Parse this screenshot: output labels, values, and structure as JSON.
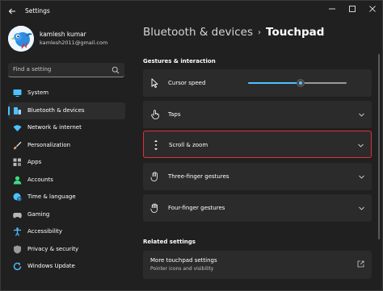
{
  "window": {
    "title": "Settings"
  },
  "profile": {
    "name": "kamlesh kumar",
    "email": "kamlesh2011@gmail.com"
  },
  "search": {
    "placeholder": "Find a setting"
  },
  "nav": {
    "items": [
      {
        "label": "System",
        "icon": "monitor-icon",
        "color": "#4cc2ff"
      },
      {
        "label": "Bluetooth & devices",
        "icon": "bluetooth-devices-icon",
        "color": "#4cc2ff",
        "active": true
      },
      {
        "label": "Network & internet",
        "icon": "wifi-icon",
        "color": "#4cc2ff"
      },
      {
        "label": "Personalization",
        "icon": "brush-icon",
        "color": "#f0a35e"
      },
      {
        "label": "Apps",
        "icon": "apps-icon",
        "color": "#b6b6b6"
      },
      {
        "label": "Accounts",
        "icon": "person-icon",
        "color": "#3ddc84"
      },
      {
        "label": "Time & language",
        "icon": "globe-clock-icon",
        "color": "#4cc2ff"
      },
      {
        "label": "Gaming",
        "icon": "gamepad-icon",
        "color": "#b6b6b6"
      },
      {
        "label": "Accessibility",
        "icon": "accessibility-icon",
        "color": "#4cc2ff"
      },
      {
        "label": "Privacy & security",
        "icon": "shield-icon",
        "color": "#9a9a9a"
      },
      {
        "label": "Windows Update",
        "icon": "sync-icon",
        "color": "#4cc2ff"
      }
    ]
  },
  "breadcrumb": {
    "parent": "Bluetooth & devices",
    "separator": "›",
    "current": "Touchpad"
  },
  "sections": {
    "gestures": "Gestures & interaction",
    "related": "Related settings"
  },
  "cards": {
    "cursor_speed": {
      "label": "Cursor speed",
      "slider_value": 0.53
    },
    "taps": {
      "label": "Taps"
    },
    "scroll_zoom": {
      "label": "Scroll & zoom"
    },
    "three_finger": {
      "label": "Three-finger gestures"
    },
    "four_finger": {
      "label": "Four-finger gestures"
    }
  },
  "related": {
    "more_touchpad": {
      "title": "More touchpad settings",
      "subtitle": "Pointer icons and visibility"
    }
  },
  "colors": {
    "accent": "#4cc2ff",
    "selection_border": "#e0303c",
    "card_bg": "#2b2b2b",
    "window_bg": "#202020"
  }
}
